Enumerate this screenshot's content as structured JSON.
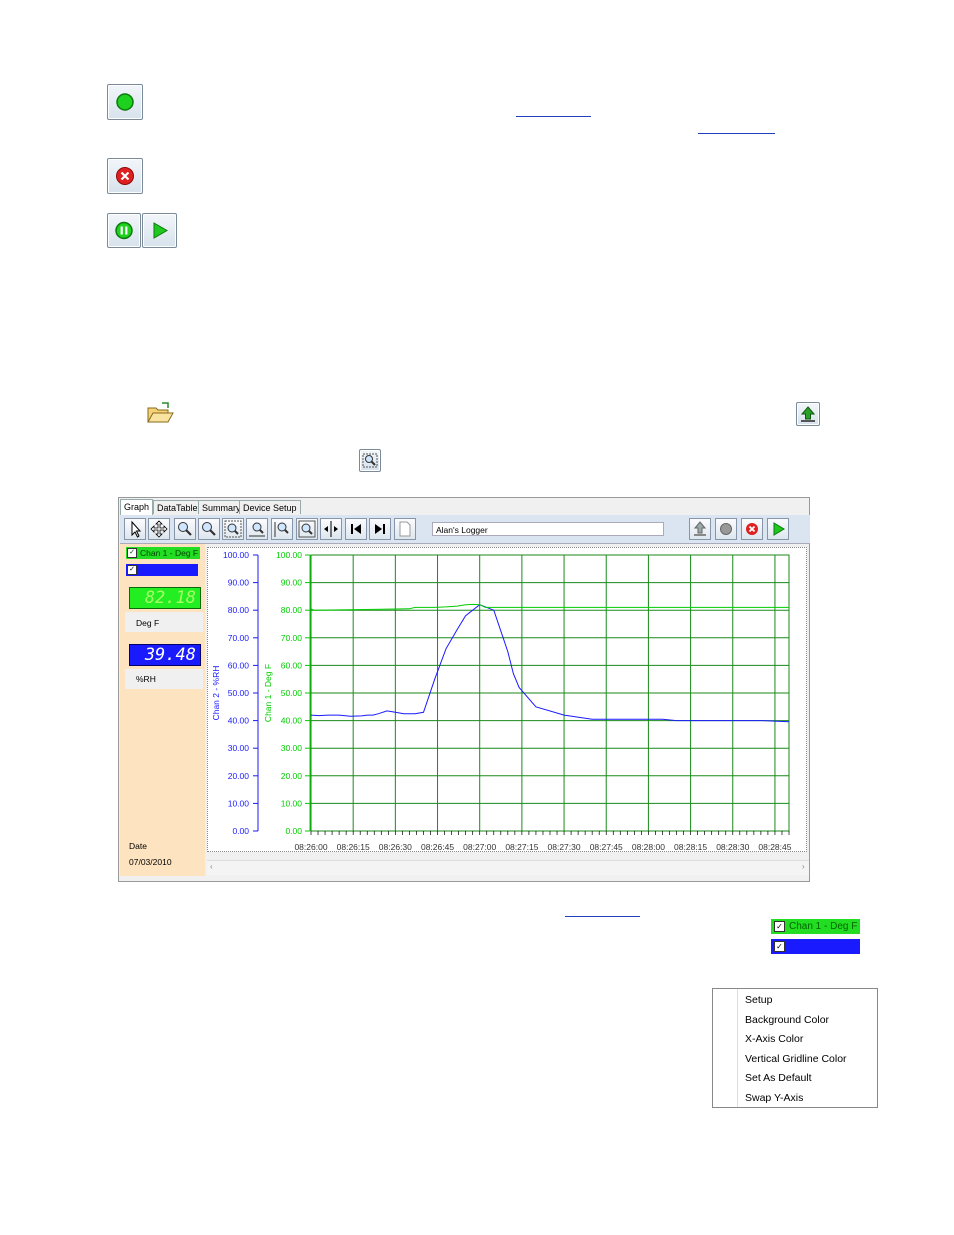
{
  "icons": {
    "record": "green-circle-icon",
    "stop": "red-x-icon",
    "pause": "pause-icon",
    "play": "play-icon",
    "open": "open-folder-icon",
    "download": "download-icon",
    "zoom": "zoom-fit-icon"
  },
  "tabs": [
    "Graph",
    "DataTable",
    "Summary",
    "Device Setup"
  ],
  "logger_name": "Alan's Logger",
  "channels": {
    "ch1_label": "Chan 1 - Deg F",
    "ch2_label": "Chan 2 - %RH",
    "ch1_value": "82.18",
    "ch1_unit": "Deg F",
    "ch2_value": "39.48",
    "ch2_unit": "%RH"
  },
  "date_label": "Date",
  "date_value": "07/03/2010",
  "colors": {
    "ch1": "#00cc00",
    "ch2": "#1a1aff",
    "panel": "#fde3bf",
    "grid": "#1a8a1a"
  },
  "legend_standalone": {
    "ch1": "Chan 1 - Deg F",
    "ch2": "Chan 2 - %RH"
  },
  "context_menu": [
    "Setup",
    "Background Color",
    "X-Axis Color",
    "Vertical Gridline Color",
    "Set As Default",
    "Swap Y-Axis"
  ],
  "chart_data": {
    "type": "line",
    "x_ticks": [
      "08:26:00",
      "08:26:15",
      "08:26:30",
      "08:26:45",
      "08:27:00",
      "08:27:15",
      "08:27:30",
      "08:27:45",
      "08:28:00",
      "08:28:15",
      "08:28:30",
      "08:28:45"
    ],
    "y_ticks": [
      "100.00",
      "90.00",
      "80.00",
      "70.00",
      "60.00",
      "50.00",
      "40.00",
      "30.00",
      "20.00",
      "10.00",
      "0.00"
    ],
    "ylabel_left": "Chan 2 - %RH",
    "ylabel_right": "Chan 1 - Deg F",
    "ylim": [
      0,
      100
    ],
    "series": [
      {
        "name": "Chan 2 - %RH",
        "x": [
          0,
          3,
          6,
          10,
          14,
          18,
          20,
          22,
          24,
          27,
          30,
          33,
          35,
          37,
          40,
          44,
          48,
          52,
          55,
          60,
          65,
          70,
          72,
          74,
          80,
          90,
          100,
          105,
          110,
          115,
          120,
          125,
          130,
          135,
          140,
          145,
          150,
          160,
          170
        ],
        "y": [
          42,
          41.8,
          42,
          42,
          41.6,
          41.7,
          42,
          42,
          42.5,
          43.5,
          43,
          42.5,
          42.5,
          42.5,
          43,
          55,
          66,
          73,
          78,
          82,
          80,
          65,
          57,
          52,
          45,
          42,
          40.5,
          40.5,
          40.5,
          40.5,
          40.5,
          40.5,
          40,
          40,
          40,
          40,
          40,
          40,
          39.6
        ]
      },
      {
        "name": "Chan 1 - Deg F",
        "x": [
          0,
          1,
          35,
          37,
          44,
          48,
          52,
          55,
          58,
          60,
          62,
          170
        ],
        "y": [
          80.5,
          80,
          80.5,
          81,
          81,
          81.2,
          81.5,
          82,
          82.1,
          82,
          81,
          81
        ]
      }
    ]
  }
}
